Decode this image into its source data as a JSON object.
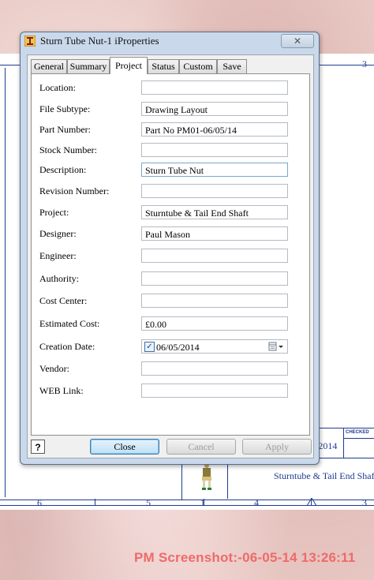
{
  "drawing": {
    "zones_top": [
      "3"
    ],
    "zones_bottom": [
      "6",
      "5",
      "1",
      "4",
      "3"
    ],
    "checked_label": "CHECKED",
    "date_fragment": "/2014",
    "project_fragment": "Sturntube & Tail End Shaft"
  },
  "stamp": "PM Screenshot:-06-05-14 13:26:11",
  "dialog": {
    "title": "Sturn Tube Nut-1 iProperties",
    "close_glyph": "✕",
    "tabs": [
      {
        "label": "General"
      },
      {
        "label": "Summary"
      },
      {
        "label": "Project"
      },
      {
        "label": "Status"
      },
      {
        "label": "Custom"
      },
      {
        "label": "Save"
      }
    ],
    "fields": {
      "location": {
        "label": "Location:",
        "value": ""
      },
      "file_subtype": {
        "label": "File Subtype:",
        "value": "Drawing Layout"
      },
      "part_number": {
        "label": "Part Number:",
        "value": "Part No PM01-06/05/14"
      },
      "stock_number": {
        "label": "Stock Number:",
        "value": ""
      },
      "description": {
        "label": "Description:",
        "value": "Sturn Tube Nut"
      },
      "revision_number": {
        "label": "Revision Number:",
        "value": ""
      },
      "project": {
        "label": "Project:",
        "value": "Sturntube & Tail End Shaft"
      },
      "designer": {
        "label": "Designer:",
        "value": "Paul Mason"
      },
      "engineer": {
        "label": "Engineer:",
        "value": ""
      },
      "authority": {
        "label": "Authority:",
        "value": ""
      },
      "cost_center": {
        "label": "Cost Center:",
        "value": ""
      },
      "estimated_cost": {
        "label": "Estimated Cost:",
        "value": "£0.00"
      },
      "creation_date": {
        "label": "Creation Date:",
        "value": "06/05/2014",
        "checked": true
      },
      "vendor": {
        "label": "Vendor:",
        "value": ""
      },
      "web_link": {
        "label": "WEB Link:",
        "value": ""
      }
    },
    "buttons": {
      "help": "?",
      "close": "Close",
      "cancel": "Cancel",
      "apply": "Apply"
    }
  }
}
